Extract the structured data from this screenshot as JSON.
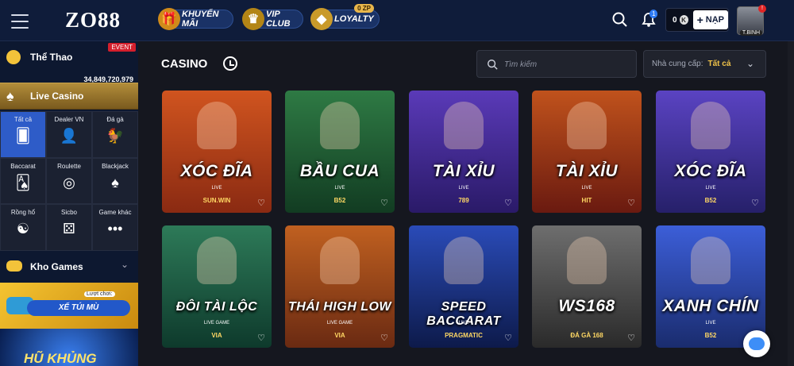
{
  "header": {
    "logo": "ZO88",
    "pills": [
      {
        "label": "KHUYẾN MÃI",
        "icon": "gift-icon"
      },
      {
        "label": "VIP CLUB",
        "icon": "crown-icon"
      },
      {
        "label": "LOYALTY",
        "icon": "diamond-icon",
        "badge": "0 ZP"
      }
    ],
    "notification_count": "1",
    "balance": "0",
    "coin": "K",
    "deposit_label": "NẠP",
    "avatar_level": "T.BINH",
    "avatar_alert": "!"
  },
  "sidebar": {
    "sports": {
      "label": "Thể Thao",
      "badge": "EVENT"
    },
    "live_casino": {
      "label": "Live Casino",
      "jackpot": "34,849,720,979"
    },
    "categories": [
      {
        "label": "Tất cả",
        "icon": "cards-icon",
        "glyph": "🂠"
      },
      {
        "label": "Dealer VN",
        "icon": "dealer-icon",
        "glyph": "👤"
      },
      {
        "label": "Đá gà",
        "icon": "rooster-icon",
        "glyph": "🐓"
      },
      {
        "label": "Baccarat",
        "icon": "baccarat-icon",
        "glyph": "🂡"
      },
      {
        "label": "Roulette",
        "icon": "roulette-icon",
        "glyph": "◎"
      },
      {
        "label": "Blackjack",
        "icon": "blackjack-icon",
        "glyph": "♠"
      },
      {
        "label": "Rồng hổ",
        "icon": "dragon-tiger-icon",
        "glyph": "☯"
      },
      {
        "label": "Sicbo",
        "icon": "dice-icon",
        "glyph": "⚄"
      },
      {
        "label": "Game khác",
        "icon": "more-icon",
        "glyph": "•••"
      }
    ],
    "kho_games": {
      "label": "Kho Games"
    },
    "banner1": {
      "label": "XẾ TÚI MÙ",
      "tag": "Lượt chơi:"
    },
    "banner2": {
      "label": "HŨ KHỦNG"
    }
  },
  "main": {
    "title": "CASINO",
    "search_placeholder": "Tìm kiếm",
    "provider_label": "Nhà cung cấp:",
    "provider_value": "Tất cả"
  },
  "games": [
    {
      "title": "XÓC ĐĨA",
      "sub": "LIVE",
      "provider": "SUN.WIN",
      "colors": [
        "#8a2a12",
        "#d0541f"
      ]
    },
    {
      "title": "BẦU CUA",
      "sub": "LIVE",
      "provider": "B52",
      "colors": [
        "#123c22",
        "#2e7a44"
      ]
    },
    {
      "title": "TÀI XỈU",
      "sub": "LIVE",
      "provider": "789",
      "colors": [
        "#2a1a68",
        "#5a3ab8"
      ]
    },
    {
      "title": "TÀI XỈU",
      "sub": "LIVE",
      "provider": "HIT",
      "colors": [
        "#6a1a10",
        "#c0521c"
      ]
    },
    {
      "title": "XÓC ĐĨA",
      "sub": "LIVE",
      "provider": "B52",
      "colors": [
        "#26206a",
        "#5a43c2"
      ]
    },
    {
      "title": "ĐÔI TÀI LỘC",
      "sub": "LIVE GAME",
      "provider": "VIA",
      "colors": [
        "#0e3a2c",
        "#2d7a58"
      ]
    },
    {
      "title": "THÁI HIGH LOW",
      "sub": "LIVE GAME",
      "provider": "VIA",
      "colors": [
        "#6a2a12",
        "#c06020"
      ]
    },
    {
      "title": "SPEED BACCARAT",
      "sub": "LIVE",
      "provider": "PRAGMATIC",
      "colors": [
        "#0d1a4a",
        "#2a4bb8"
      ]
    },
    {
      "title": "WS168",
      "sub": "",
      "provider": "ĐÁ GÀ 168",
      "colors": [
        "#2a2a2a",
        "#6e6e6e"
      ]
    },
    {
      "title": "XANH CHÍN",
      "sub": "LIVE",
      "provider": "B52",
      "colors": [
        "#1a2c6e",
        "#3c5ed8"
      ]
    }
  ],
  "colors": {
    "accent": "#2e5cc8",
    "gold": "#f0c34a",
    "header_bg": "#0f1c3a"
  }
}
